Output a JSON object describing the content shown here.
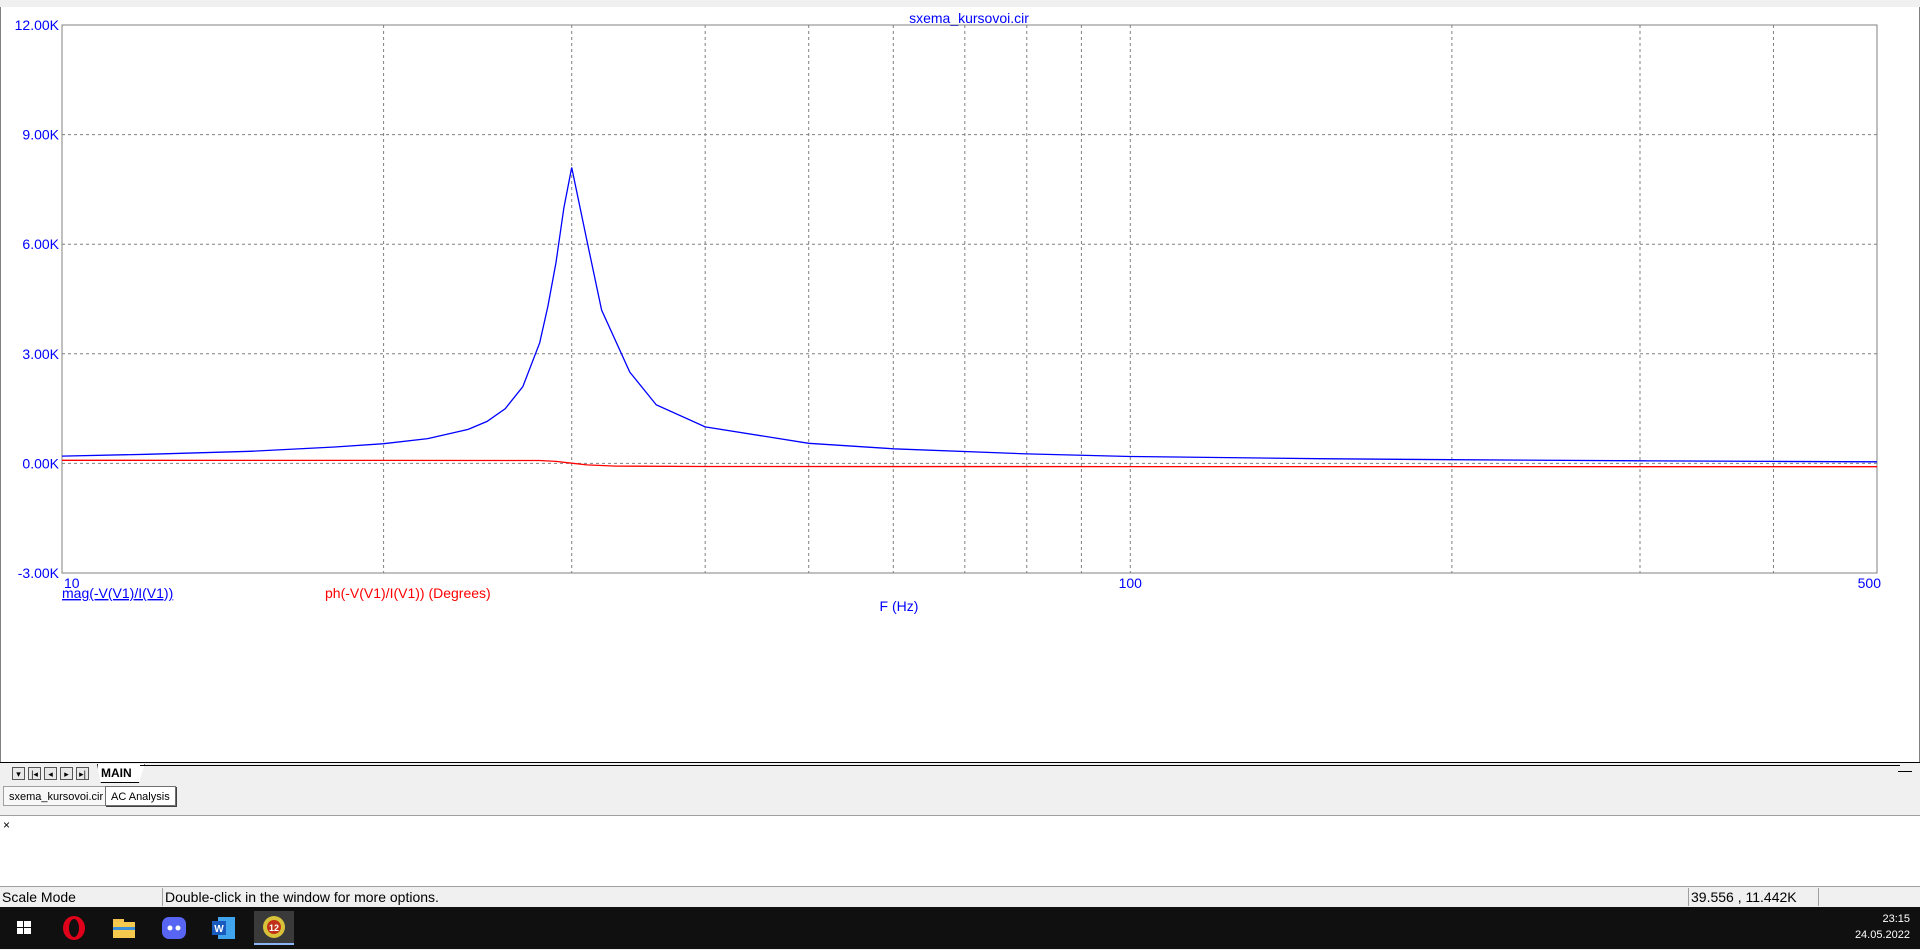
{
  "window": {
    "title": "sxema_kursovoi.cir"
  },
  "plot": {
    "x_axis_label": "F (Hz)",
    "x_ticks": [
      "10",
      "100",
      "500"
    ],
    "y_ticks": [
      "12.00K",
      "9.00K",
      "6.00K",
      "3.00K",
      "0.00K",
      "-3.00K"
    ],
    "legend": {
      "magnitude": "mag(-V(V1)/I(V1))",
      "phase": "ph(-V(V1)/I(V1)) (Degrees)"
    },
    "colors": {
      "magnitude": "#0000ff",
      "phase": "#ff0000",
      "grid": "#808080"
    }
  },
  "chart_data": {
    "type": "line",
    "title": "sxema_kursovoi.cir",
    "xlabel": "F (Hz)",
    "ylabel": "",
    "x_scale": "log",
    "xlim": [
      10,
      500
    ],
    "ylim": [
      -3000,
      12000
    ],
    "y_ticks": [
      -3000,
      0,
      3000,
      6000,
      9000,
      12000
    ],
    "grid": true,
    "series": [
      {
        "name": "mag(-V(V1)/I(V1))",
        "x": [
          10,
          12,
          15,
          18,
          20,
          22,
          24,
          25,
          26,
          27,
          28,
          28.5,
          29,
          29.5,
          30,
          31,
          32,
          34,
          36,
          40,
          50,
          60,
          80,
          100,
          150,
          200,
          300,
          400,
          500
        ],
        "y": [
          200,
          250,
          330,
          450,
          540,
          680,
          930,
          1150,
          1500,
          2100,
          3300,
          4300,
          5500,
          7000,
          8100,
          6100,
          4200,
          2500,
          1600,
          1000,
          550,
          400,
          260,
          190,
          130,
          100,
          70,
          55,
          45
        ]
      },
      {
        "name": "ph(-V(V1)/I(V1)) (Degrees)",
        "x": [
          10,
          20,
          28,
          29,
          30,
          31,
          33,
          40,
          100,
          500
        ],
        "y": [
          85,
          83,
          80,
          55,
          5,
          -40,
          -75,
          -85,
          -88,
          -89
        ]
      }
    ]
  },
  "sheet_tabs": {
    "nav": [
      "▾",
      "|◂",
      "◂",
      "▸",
      "▸|"
    ],
    "active": "MAIN"
  },
  "document_tabs": [
    "sxema_kursovoi.cir",
    "AC Analysis"
  ],
  "output_panel": {
    "close": "×"
  },
  "status_bar": {
    "mode": "Scale Mode",
    "hint": "Double-click in the window for more options.",
    "coords": "39.556 , 11.442K"
  },
  "taskbar": {
    "icons": [
      "windows-start-icon",
      "opera-icon",
      "file-explorer-icon",
      "discord-icon",
      "word-icon",
      "microcap-icon"
    ],
    "time": "23:15",
    "date": "24.05.2022"
  }
}
